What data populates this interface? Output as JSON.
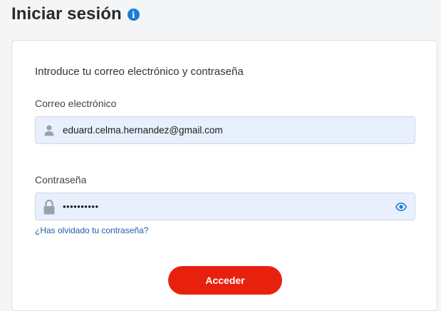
{
  "header": {
    "title": "Iniciar sesión",
    "info_icon": "info-icon",
    "info_glyph": "i"
  },
  "form": {
    "intro": "Introduce tu correo electrónico y contraseña",
    "email_label": "Correo electrónico",
    "email_value": "eduard.celma.hernandez@gmail.com",
    "password_label": "Contraseña",
    "password_value": "••••••••••",
    "forgot_link": "¿Has olvidado tu contraseña?",
    "submit_label": "Acceder"
  },
  "icons": {
    "email": "user-icon",
    "password": "lock-icon",
    "toggle": "eye-icon"
  },
  "colors": {
    "accent": "#e8210f",
    "info": "#1b7cd8",
    "field_bg": "#e8f0fe",
    "link": "#1f5fa8"
  }
}
